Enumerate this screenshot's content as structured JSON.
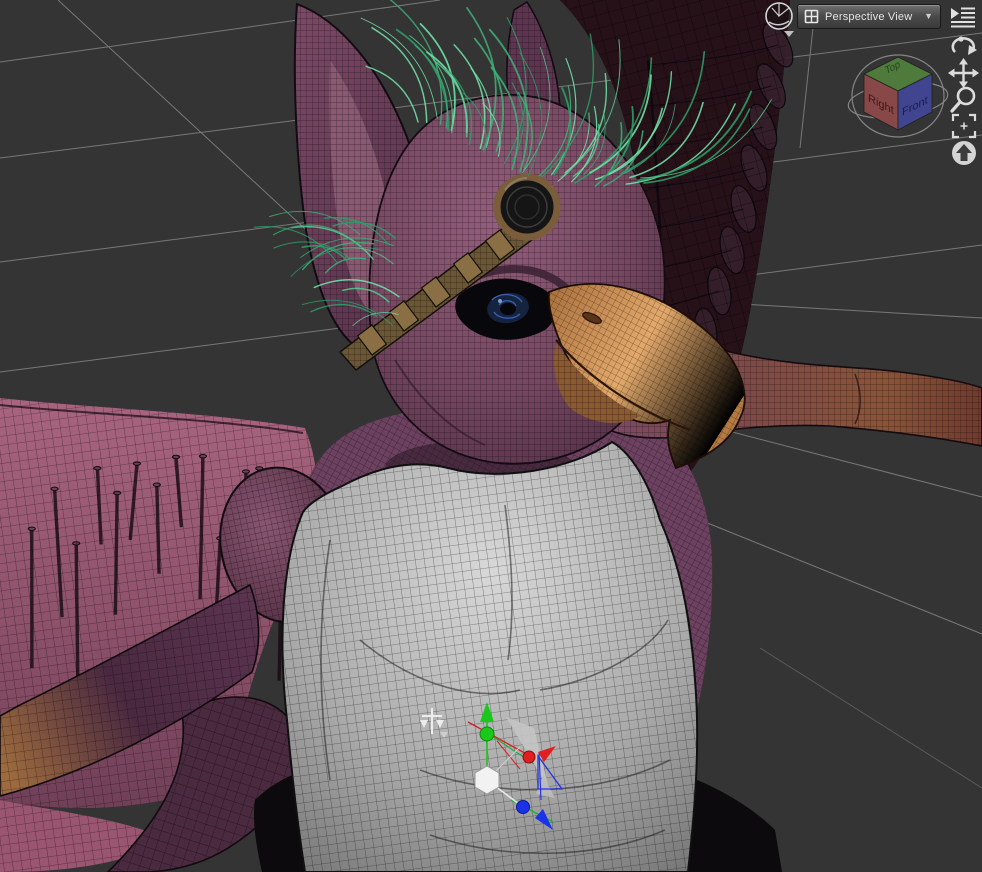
{
  "viewport": {
    "background_color": "#343434",
    "grid_line_color": "#8f8f8f",
    "view_selector": {
      "label": "Perspective View",
      "caret": "▼",
      "icon": "pane-icon"
    },
    "style_selector": {
      "icon": "shaded-sphere-icon",
      "caret": "▼"
    },
    "menu_icon": "viewport-menu-icon",
    "tools": [
      {
        "name": "orbit-camera"
      },
      {
        "name": "pan-camera"
      },
      {
        "name": "zoom-camera"
      },
      {
        "name": "frame-selection"
      },
      {
        "name": "reset-camera"
      }
    ]
  },
  "view_cube": {
    "top_label": "Top",
    "right_label": "Right",
    "front_label": "Front",
    "face_colors": {
      "top": "#4e7a3c",
      "right": "#9c5353",
      "front": "#5055b0"
    }
  },
  "gizmo": {
    "x_axis_color": "#e02020",
    "y_axis_color": "#19c819",
    "z_axis_color": "#1c32e8",
    "center_handle": "hexagon"
  },
  "scene": {
    "subject": "wireframe-shaded anthro griffin character, T-pose, goggles and green hair",
    "colors": {
      "skin_purple": "#74465f",
      "beak_orange": "#c98950",
      "hair_green": "#55cb8e",
      "vest_gray": "#b2b2b2",
      "wing_dark": "#261119",
      "wing_pink": "#a8647e"
    }
  }
}
